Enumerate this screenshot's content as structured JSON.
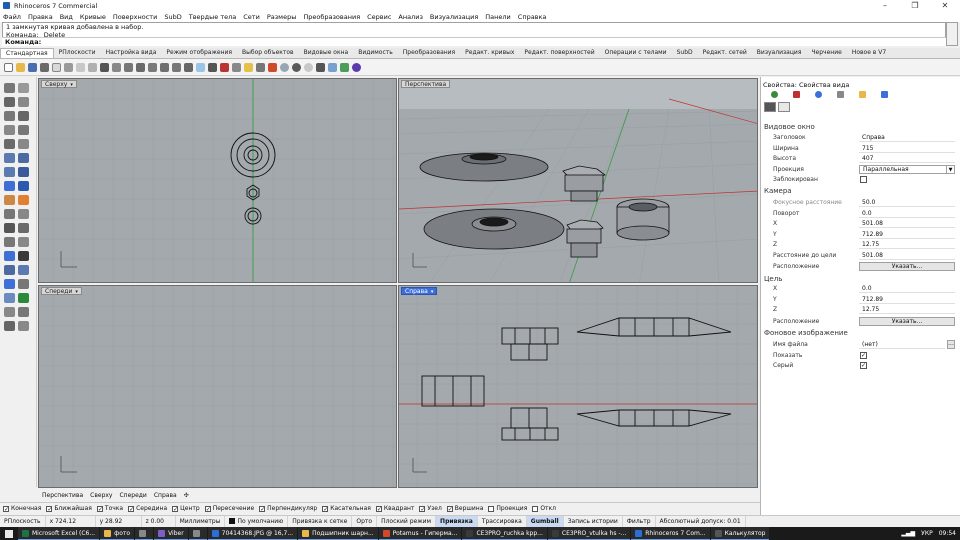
{
  "window": {
    "title": "Rhinoceros 7 Commercial",
    "minimize": "–",
    "maximize": "❐",
    "close": "✕"
  },
  "menu": [
    "Файл",
    "Правка",
    "Вид",
    "Кривые",
    "Поверхности",
    "SubD",
    "Твердые тела",
    "Сети",
    "Размеры",
    "Преобразования",
    "Сервис",
    "Анализ",
    "Визуализация",
    "Панели",
    "Справка"
  ],
  "command": {
    "history": [
      "1 замкнутая кривая добавлена в набор.",
      "Команда: _Delete"
    ],
    "prompt": "Команда:"
  },
  "toolbar_tabs": [
    "Стандартная",
    "РПлоскости",
    "Настройка вида",
    "Режим отображения",
    "Выбор объектов",
    "Видовые окна",
    "Видимость",
    "Преобразования",
    "Редакт. кривых",
    "Редакт. поверхностей",
    "Операции с телами",
    "SubD",
    "Редакт. сетей",
    "Визуализация",
    "Черчение",
    "Новое в V7"
  ],
  "toolbar_tabs_active": 0,
  "viewports": {
    "top": "Сверху",
    "perspective": "Перспектива",
    "front": "Спереди",
    "right": "Справа"
  },
  "viewport_tabs": [
    "Перспектива",
    "Сверху",
    "Спереди",
    "Справа",
    "✣"
  ],
  "osnaps": [
    {
      "label": "Конечная",
      "checked": true
    },
    {
      "label": "Ближайшая",
      "checked": true
    },
    {
      "label": "Точка",
      "checked": true
    },
    {
      "label": "Середина",
      "checked": true
    },
    {
      "label": "Центр",
      "checked": true
    },
    {
      "label": "Пересечение",
      "checked": true
    },
    {
      "label": "Перпендикуляр",
      "checked": true
    },
    {
      "label": "Касательная",
      "checked": true
    },
    {
      "label": "Квадрант",
      "checked": true
    },
    {
      "label": "Узел",
      "checked": true
    },
    {
      "label": "Вершина",
      "checked": true
    },
    {
      "label": "Проекция",
      "checked": false
    },
    {
      "label": "Откл",
      "checked": false
    }
  ],
  "status": {
    "cplane": "РПлоскость",
    "x": "x 724.12",
    "y": "y 28.92",
    "z": "z 0.00",
    "units": "Миллиметры",
    "layer": "По умолчанию",
    "items": [
      "Привязка к сетке",
      "Орто",
      "Плоский режим",
      "Привязка",
      "Трассировка",
      "Gumball",
      "Запись истории",
      "Фильтр"
    ],
    "active_items": [
      "Привязка",
      "Gumball"
    ],
    "tolerance": "Абсолютный допуск: 0.01"
  },
  "panel": {
    "title": "Свойства: Свойства вида",
    "section_viewport": "Видовое окно",
    "viewport_rows": [
      {
        "label": "Заголовок",
        "value": "Справа"
      },
      {
        "label": "Ширина",
        "value": "715"
      },
      {
        "label": "Высота",
        "value": "407"
      }
    ],
    "projection_label": "Проекция",
    "projection_value": "Параллельная",
    "locked_label": "Заблокирован",
    "section_camera": "Камера",
    "camera_rows": [
      {
        "label": "Фокусное расстояние",
        "value": "50.0",
        "dim": true
      },
      {
        "label": "Поворот",
        "value": "0.0",
        "dim": false
      },
      {
        "label": "X",
        "value": "501.08",
        "dim": false
      },
      {
        "label": "Y",
        "value": "712.89",
        "dim": false
      },
      {
        "label": "Z",
        "value": "12.75",
        "dim": false
      },
      {
        "label": "Расстояние до цели",
        "value": "501.08",
        "dim": false
      }
    ],
    "camera_place_label": "Расположение",
    "place_button": "Указать...",
    "section_target": "Цель",
    "target_rows": [
      {
        "label": "X",
        "value": "0.0"
      },
      {
        "label": "Y",
        "value": "712.89"
      },
      {
        "label": "Z",
        "value": "12.75"
      }
    ],
    "target_place_label": "Расположение",
    "section_wallpaper": "Фоновое изображение",
    "filename_label": "Имя файла",
    "filename_value": "(нет)",
    "browse": "...",
    "show_label": "Показать",
    "gray_label": "Серый",
    "check_mark": "✓"
  },
  "taskbar": {
    "items": [
      {
        "label": "Microsoft Excel (C6...",
        "color": "#1f7244"
      },
      {
        "label": "фото",
        "color": "#e8b84a"
      },
      {
        "label": "",
        "color": "#888888"
      },
      {
        "label": "Viber",
        "color": "#7d5fc7"
      },
      {
        "label": "",
        "color": "#888888"
      },
      {
        "label": "70414368.JPG @ 16,7...",
        "color": "#2c6ed6"
      },
      {
        "label": "Подшипник шарн...",
        "color": "#e8b84a"
      },
      {
        "label": "Potamus - Гиперма...",
        "color": "#d04a2a"
      },
      {
        "label": "CE3PRO_ruchka kpp...",
        "color": "#3a3a3a"
      },
      {
        "label": "CE3PRO_vtulka hs -...",
        "color": "#3a3a3a"
      },
      {
        "label": "Rhinoceros 7 Com...",
        "color": "#2c6ed6"
      },
      {
        "label": "Калькулятор",
        "color": "#555555"
      }
    ],
    "lang": "УКР",
    "time": "09:54"
  }
}
